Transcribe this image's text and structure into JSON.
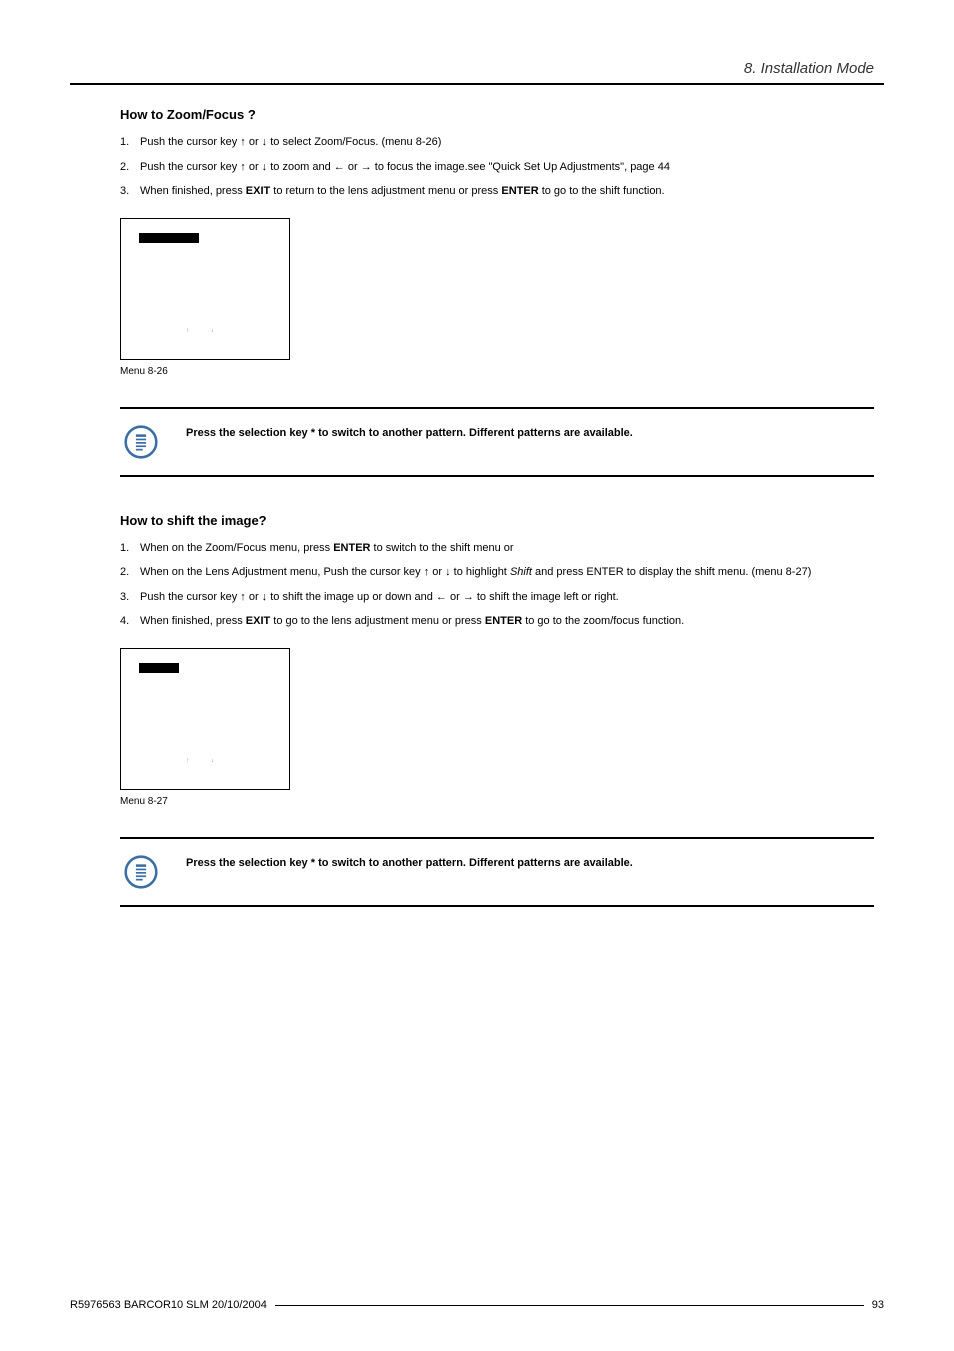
{
  "header": {
    "chapter": "8. Installation Mode"
  },
  "section1": {
    "heading": "How to Zoom/Focus ?",
    "steps": [
      {
        "num": "1.",
        "pre": "Push the cursor key ↑ or ↓ to select Zoom/Focus. (menu 8-26)"
      },
      {
        "num": "2.",
        "pre": "Push the cursor key ↑ or ↓ to zoom and ← or → to focus the image.see \"Quick Set Up Adjustments\", page 44"
      },
      {
        "num": "3.",
        "pre": "When finished, press ",
        "bold1": "EXIT",
        "mid": " to return to the lens adjustment menu or press ",
        "bold2": "ENTER",
        "post": " to go to the shift function."
      }
    ],
    "menu_arrows": "↑   ↓",
    "menu_caption": "Menu 8-26"
  },
  "note1": {
    "text": "Press the selection key * to switch to another pattern. Different patterns are available."
  },
  "section2": {
    "heading": "How to shift the image?",
    "steps": [
      {
        "num": "1.",
        "pre": "When on the Zoom/Focus menu, press ",
        "bold1": "ENTER",
        "post": " to switch to the shift menu or"
      },
      {
        "num": "2.",
        "pre": "When on the Lens Adjustment menu, Push the cursor key ↑ or ↓ to highlight ",
        "italic": "Shift",
        "post": " and press ENTER to display the shift menu. (menu 8-27)"
      },
      {
        "num": "3.",
        "pre": "Push the cursor key ↑ or ↓ to shift the image up or down and ← or → to shift the image left or right."
      },
      {
        "num": "4.",
        "pre": "When finished, press ",
        "bold1": "EXIT",
        "mid": " to go to the lens adjustment menu or press ",
        "bold2": "ENTER",
        "post": " to go to the zoom/focus function."
      }
    ],
    "menu_arrows": "↑   ↓",
    "menu_caption": "Menu 8-27"
  },
  "note2": {
    "text": "Press the selection key * to switch to another pattern. Different patterns are available."
  },
  "footer": {
    "doc_id": "R5976563 BARCOR10 SLM 20/10/2004",
    "page": "93"
  }
}
